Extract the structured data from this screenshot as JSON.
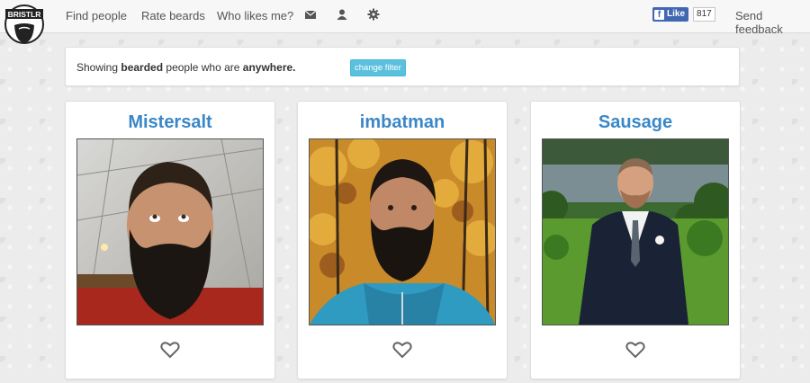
{
  "app": {
    "logo_text": "BRISTLR"
  },
  "nav": {
    "links": [
      "Find people",
      "Rate beards",
      "Who likes me?"
    ],
    "icons": [
      "mail-icon",
      "user-icon",
      "gear-icon"
    ],
    "send_feedback": "Send feedback"
  },
  "facebook": {
    "like_label": "Like",
    "count": "817"
  },
  "filter": {
    "prefix": "Showing ",
    "bold1": "bearded",
    "middle": " people who are ",
    "bold2": "anywhere.",
    "button_label": "change filter"
  },
  "people": [
    {
      "name": "Mistersalt"
    },
    {
      "name": "imbatman"
    },
    {
      "name": "Sausage"
    }
  ],
  "colors": {
    "accent": "#3a87c8",
    "filter_button": "#5bc0de",
    "facebook": "#4267b2"
  }
}
